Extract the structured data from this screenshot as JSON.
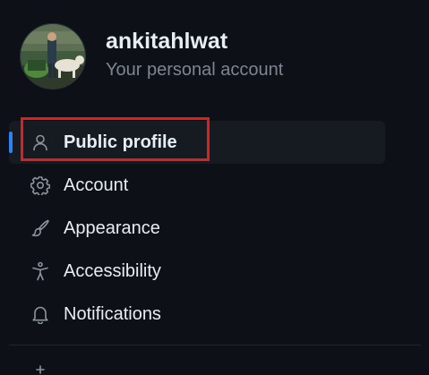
{
  "profile": {
    "username": "ankitahlwat",
    "subtitle": "Your personal account"
  },
  "nav": {
    "items": [
      {
        "label": "Public profile",
        "icon": "person-icon",
        "selected": true
      },
      {
        "label": "Account",
        "icon": "gear-icon",
        "selected": false
      },
      {
        "label": "Appearance",
        "icon": "paintbrush-icon",
        "selected": false
      },
      {
        "label": "Accessibility",
        "icon": "accessibility-icon",
        "selected": false
      },
      {
        "label": "Notifications",
        "icon": "bell-icon",
        "selected": false
      }
    ]
  },
  "colors": {
    "background": "#0d1117",
    "selected_bg": "#161b22",
    "accent": "#2f81f7",
    "highlight": "#e11d1d",
    "text": "#e6edf3",
    "muted": "#7d8590"
  }
}
